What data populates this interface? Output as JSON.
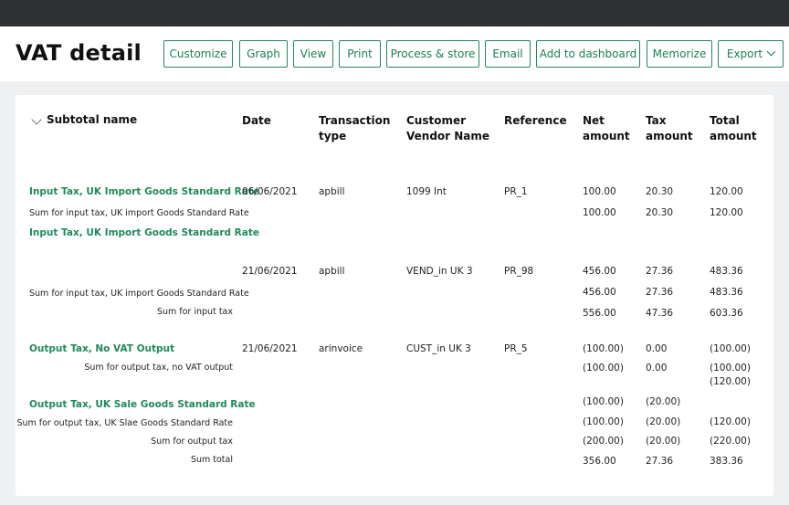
{
  "page": {
    "title": "VAT detail"
  },
  "toolbar": {
    "customize": "Customize",
    "graph": "Graph",
    "view": "View",
    "print": "Print",
    "process_store": "Process & store",
    "email": "Email",
    "add_dashboard": "Add to dashboard",
    "memorize": "Memorize",
    "export": "Export"
  },
  "columns": {
    "subtotal": "Subtotal name",
    "date": "Date",
    "txn_type_1": "Transaction",
    "txn_type_2": "type",
    "cust_1": "Customer",
    "cust_2": "Vendor Name",
    "ref": "Reference",
    "net_1": "Net",
    "net_2": "amount",
    "tax_1": "Tax",
    "tax_2": "amount",
    "total_1": "Total",
    "total_2": "amount"
  },
  "rows": {
    "g1_name": "Input Tax, UK Import Goods Standard Rate",
    "r1": {
      "date": "06/06/2021",
      "type": "apbill",
      "name": "1099 Int",
      "ref": "PR_1",
      "net": "100.00",
      "tax": "20.30",
      "total": "120.00"
    },
    "s1": {
      "label": "Sum for input tax, UK import Goods Standard Rate",
      "net": "100.00",
      "tax": "20.30",
      "total": "120.00"
    },
    "g2_name": "Input Tax, UK Import Goods Standard Rate",
    "r2": {
      "date": "21/06/2021",
      "type": "apbill",
      "name": "VEND_in UK 3",
      "ref": "PR_98",
      "net": "456.00",
      "tax": "27.36",
      "total": "483.36"
    },
    "s2": {
      "label": "Sum for input tax, UK import Goods Standard Rate",
      "net": "456.00",
      "tax": "27.36",
      "total": "483.36"
    },
    "s3": {
      "label": "Sum for input tax",
      "net": "556.00",
      "tax": "47.36",
      "total": "603.36"
    },
    "g3_name": "Output Tax, No VAT Output",
    "r3": {
      "date": "21/06/2021",
      "type": "arinvoice",
      "name": "CUST_in UK 3",
      "ref": "PR_5",
      "net": "(100.00)",
      "tax": "0.00",
      "total": "(100.00)"
    },
    "s4": {
      "label": "Sum for output tax, no VAT output",
      "net": "(100.00)",
      "tax": "0.00",
      "total": "(100.00)",
      "total_2": "(120.00)"
    },
    "g4_name": "Output Tax, UK Sale Goods Standard Rate",
    "g4": {
      "net": "(100.00)",
      "tax": "(20.00)"
    },
    "s5": {
      "label": "Sum for output tax, UK Slae Goods Standard Rate",
      "net": "(100.00)",
      "tax": "(20.00)",
      "total": "(120.00)"
    },
    "s6": {
      "label": "Sum for output tax",
      "net": "(200.00)",
      "tax": "(20.00)",
      "total": "(220.00)"
    },
    "s7": {
      "label": "Sum total",
      "net": "356.00",
      "tax": "27.36",
      "total": "383.36"
    }
  }
}
